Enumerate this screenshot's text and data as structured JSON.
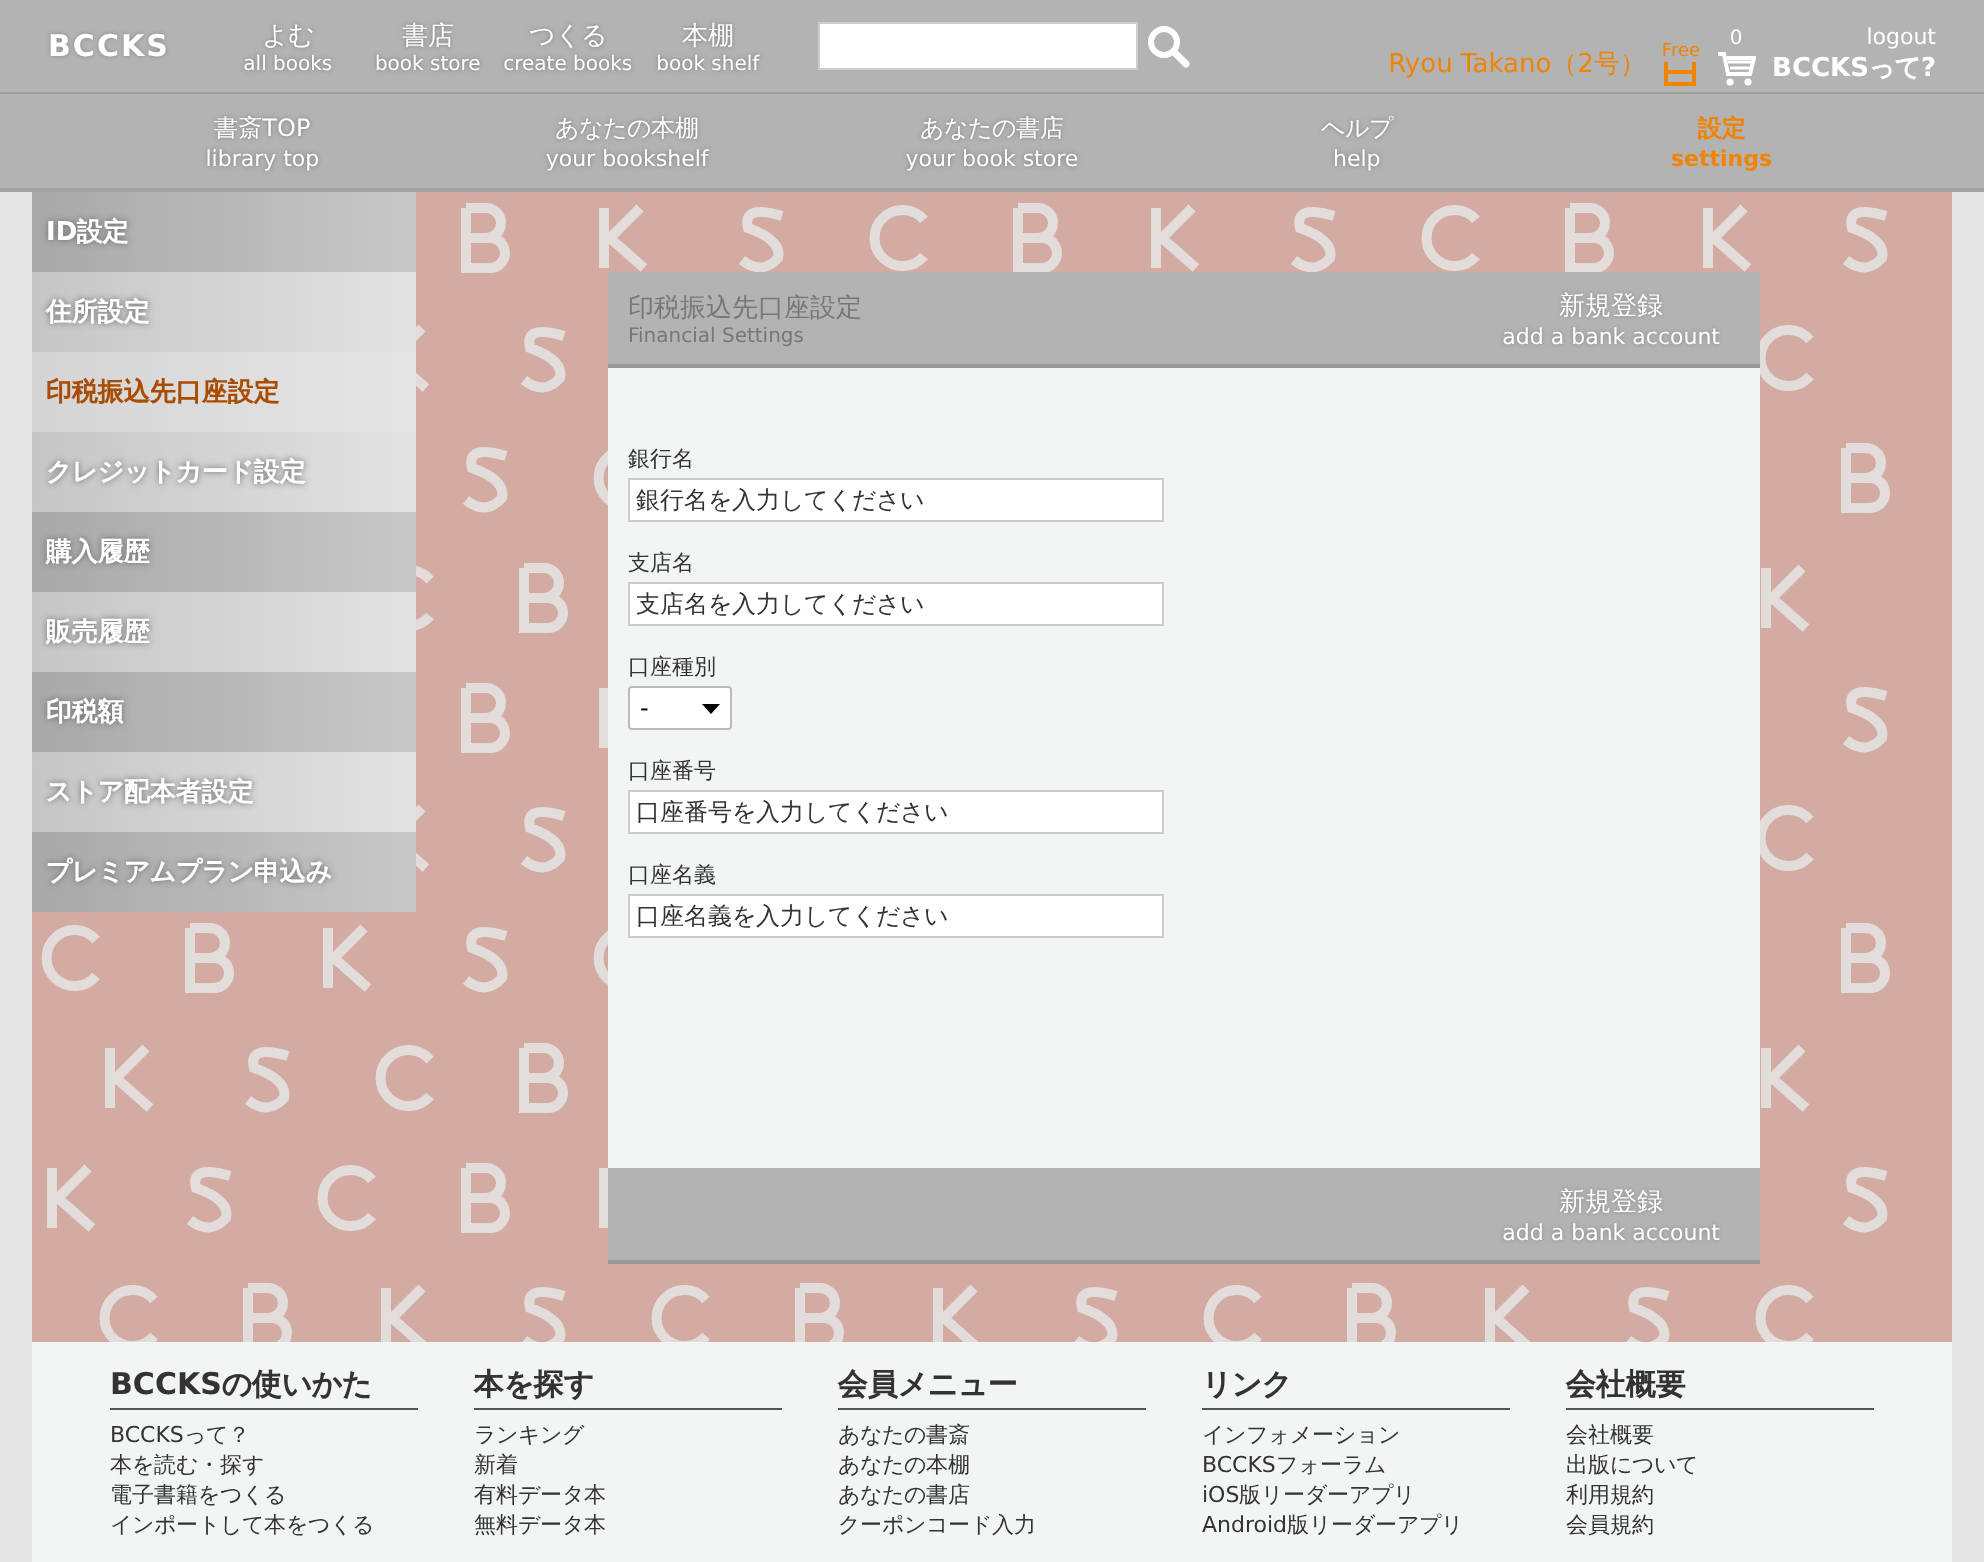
{
  "header": {
    "logo": "BCCKS",
    "nav": [
      {
        "ja": "よむ",
        "en": "all books"
      },
      {
        "ja": "書店",
        "en": "book store"
      },
      {
        "ja": "つくる",
        "en": "create books"
      },
      {
        "ja": "本棚",
        "en": "book shelf"
      }
    ],
    "user": "Ryou Takano（2号）",
    "free_badge": "Free",
    "cart_count": "0",
    "logout": "logout",
    "about": "BCCKSって?"
  },
  "subnav": [
    {
      "ja": "書斎TOP",
      "en": "library top",
      "selected": false
    },
    {
      "ja": "あなたの本棚",
      "en": "your bookshelf",
      "selected": false
    },
    {
      "ja": "あなたの書店",
      "en": "your book store",
      "selected": false
    },
    {
      "ja": "ヘルプ",
      "en": "help",
      "selected": false
    },
    {
      "ja": "設定",
      "en": "settings",
      "selected": true
    }
  ],
  "sidebar": {
    "items": [
      {
        "label": "ID設定",
        "selected": false
      },
      {
        "label": "住所設定",
        "selected": false
      },
      {
        "label": "印税振込先口座設定",
        "selected": true
      },
      {
        "label": "クレジットカード設定",
        "selected": false
      },
      {
        "label": "購入履歴",
        "selected": false
      },
      {
        "label": "販売履歴",
        "selected": false
      },
      {
        "label": "印税額",
        "selected": false
      },
      {
        "label": "ストア配本者設定",
        "selected": false
      },
      {
        "label": "プレミアムプラン申込み",
        "selected": false
      }
    ]
  },
  "panel": {
    "title": "印税振込先口座設定",
    "subtitle": "Financial Settings",
    "action_top": {
      "ja": "新規登録",
      "en": "add a bank account"
    },
    "fields": [
      {
        "kind": "text",
        "label": "銀行名",
        "placeholder": "銀行名を入力してください"
      },
      {
        "kind": "text",
        "label": "支店名",
        "placeholder": "支店名を入力してください"
      },
      {
        "kind": "select",
        "label": "口座種別",
        "value": "-"
      },
      {
        "kind": "text",
        "label": "口座番号",
        "placeholder": "口座番号を入力してください"
      },
      {
        "kind": "text",
        "label": "口座名義",
        "placeholder": "口座名義を入力してください"
      }
    ],
    "action_bottom": {
      "ja": "新規登録",
      "en": "add a bank account"
    }
  },
  "footer": {
    "columns": [
      {
        "heading": "BCCKSの使いかた",
        "links": [
          "BCCKSって？",
          "本を読む・探す",
          "電子書籍をつくる",
          "インポートして本をつくる"
        ]
      },
      {
        "heading": "本を探す",
        "links": [
          "ランキング",
          "新着",
          "有料データ本",
          "無料データ本"
        ]
      },
      {
        "heading": "会員メニュー",
        "links": [
          "あなたの書斎",
          "あなたの本棚",
          "あなたの書店",
          "クーポンコード入力"
        ]
      },
      {
        "heading": "リンク",
        "links": [
          "インフォメーション",
          "BCCKSフォーラム",
          "iOS版リーダーアプリ",
          "Android版リーダーアプリ"
        ]
      },
      {
        "heading": "会社概要",
        "links": [
          "会社概要",
          "出版について",
          "利用規約",
          "会員規約"
        ]
      }
    ]
  }
}
